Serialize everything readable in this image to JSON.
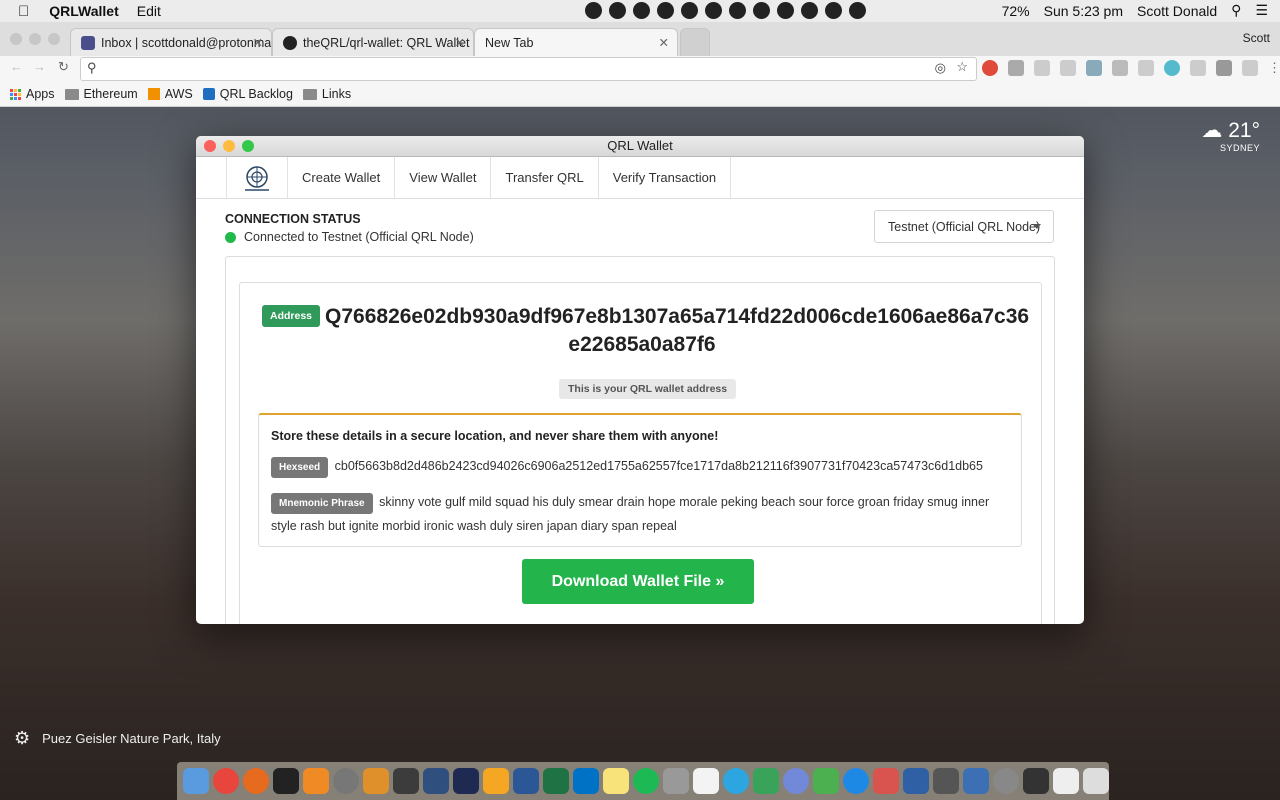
{
  "menubar": {
    "app": "QRLWallet",
    "edit": "Edit",
    "battery": "72%",
    "clock": "Sun 5:23 pm",
    "user": "Scott Donald"
  },
  "chrome": {
    "tabs": [
      {
        "title": "Inbox | scottdonald@protonma",
        "active": false
      },
      {
        "title": "theQRL/qrl-wallet: QRL Wallet",
        "active": false
      },
      {
        "title": "New Tab",
        "active": true
      }
    ],
    "profile": "Scott",
    "bookmarks": [
      "Apps",
      "Ethereum",
      "AWS",
      "QRL Backlog",
      "Links"
    ]
  },
  "window": {
    "title": "QRL Wallet"
  },
  "nav": {
    "items": [
      "Create Wallet",
      "View Wallet",
      "Transfer QRL",
      "Verify Transaction"
    ]
  },
  "connection": {
    "heading": "CONNECTION STATUS",
    "status": "Connected to Testnet (Official QRL Node)",
    "selected_network": "Testnet (Official QRL Node)"
  },
  "wallet": {
    "address_label": "Address",
    "address_line1": "Q766826e02db930a9df967e8b1307a65a714fd22d006cde1606ae86a7c36",
    "address_line2": "e22685a0a87f6",
    "address_note": "This is your QRL wallet address",
    "warning": "Store these details in a secure location, and never share them with anyone!",
    "hexseed_label": "Hexseed",
    "hexseed": "cb0f5663b8d2d486b2423cd94026c6906a2512ed1755a62557fce1717da8b212116f3907731f70423ca57473c6d1db65",
    "mnemonic_label": "Mnemonic Phrase",
    "mnemonic": "skinny vote gulf mild squad his duly smear drain hope morale peking beach sour force groan friday smug inner style rash but ignite morbid ironic wash duly siren japan diary span repeal",
    "download_label": "Download Wallet File »"
  },
  "weather": {
    "temp": "21°",
    "city": "SYDNEY"
  },
  "background": {
    "caption": "Puez Geisler Nature Park, Italy"
  },
  "colors": {
    "green": "#23b44c",
    "address_badge": "#2f9a5a",
    "warning_border": "#e0a42e"
  }
}
